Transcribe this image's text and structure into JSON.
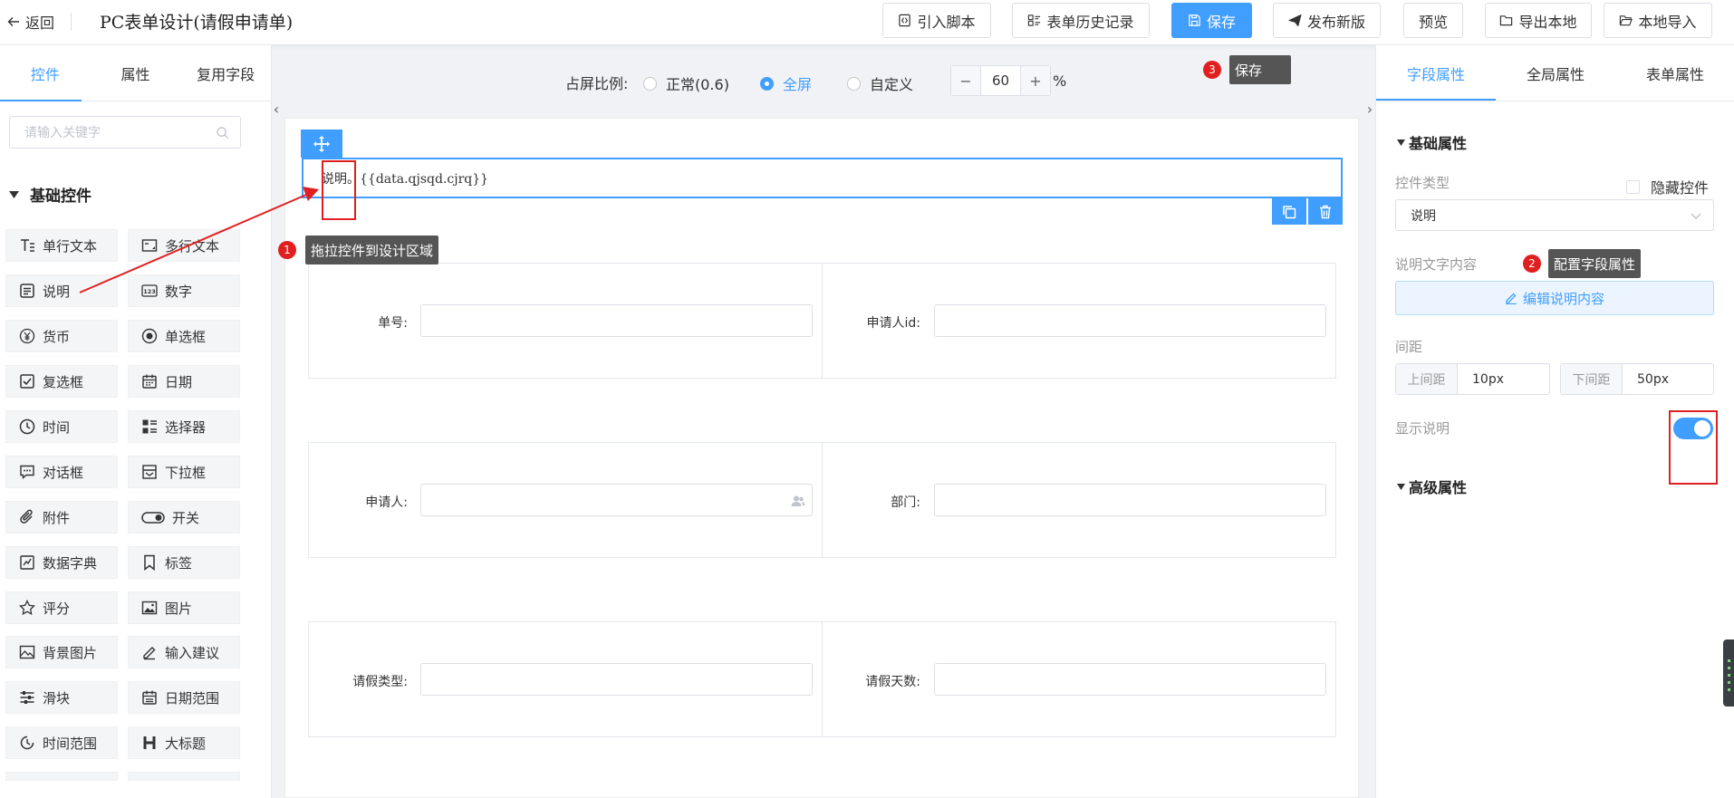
{
  "header": {
    "back_label": "返回",
    "title": "PC表单设计(请假申请单)",
    "buttons": {
      "import_script": "引入脚本",
      "history": "表单历史记录",
      "save": "保存",
      "publish": "发布新版",
      "preview": "预览",
      "export_local": "导出本地",
      "import_local": "本地导入"
    }
  },
  "left_panel": {
    "tabs": [
      "控件",
      "属性",
      "复用字段"
    ],
    "active_tab": 0,
    "search_placeholder": "请输入关键字",
    "section_title": "基础控件",
    "controls": [
      {
        "label": "单行文本",
        "icon": "single-line-text-icon"
      },
      {
        "label": "多行文本",
        "icon": "multi-line-text-icon"
      },
      {
        "label": "说明",
        "icon": "description-icon"
      },
      {
        "label": "数字",
        "icon": "number-icon"
      },
      {
        "label": "货币",
        "icon": "currency-icon"
      },
      {
        "label": "单选框",
        "icon": "radio-icon"
      },
      {
        "label": "复选框",
        "icon": "checkbox-icon"
      },
      {
        "label": "日期",
        "icon": "calendar-icon"
      },
      {
        "label": "时间",
        "icon": "clock-icon"
      },
      {
        "label": "选择器",
        "icon": "selector-icon"
      },
      {
        "label": "对话框",
        "icon": "dialog-icon"
      },
      {
        "label": "下拉框",
        "icon": "dropdown-icon"
      },
      {
        "label": "附件",
        "icon": "attachment-icon"
      },
      {
        "label": "开关",
        "icon": "switch-icon"
      },
      {
        "label": "数据字典",
        "icon": "data-dictionary-icon"
      },
      {
        "label": "标签",
        "icon": "tag-icon"
      },
      {
        "label": "评分",
        "icon": "star-icon"
      },
      {
        "label": "图片",
        "icon": "image-icon"
      },
      {
        "label": "背景图片",
        "icon": "background-image-icon"
      },
      {
        "label": "输入建议",
        "icon": "input-suggestion-icon"
      },
      {
        "label": "滑块",
        "icon": "slider-icon"
      },
      {
        "label": "日期范围",
        "icon": "date-range-icon"
      },
      {
        "label": "时间范围",
        "icon": "time-range-icon"
      },
      {
        "label": "大标题",
        "icon": "heading-icon"
      }
    ]
  },
  "canvas": {
    "ratio_label": "占屏比例:",
    "ratio_options": [
      "正常(0.6)",
      "全屏",
      "自定义"
    ],
    "ratio_selected": 1,
    "custom_value": "60",
    "percent_sign": "%",
    "stepper_minus": "−",
    "stepper_plus": "+",
    "selected_field_text": "说明。{{data.qjsqd.cjrq}}",
    "form_rows": [
      [
        {
          "label": "单号:"
        },
        {
          "label": "申请人id:"
        }
      ],
      [
        {
          "label": "申请人:",
          "icon": "user-picker-icon"
        },
        {
          "label": "部门:"
        }
      ],
      [
        {
          "label": "请假类型:"
        },
        {
          "label": "请假天数:"
        }
      ]
    ]
  },
  "annotations": [
    {
      "number": "1",
      "text": "拖拉控件到设计区域"
    },
    {
      "number": "2",
      "text": "配置字段属性"
    },
    {
      "number": "3",
      "text": "保存"
    }
  ],
  "right_panel": {
    "tabs": [
      "字段属性",
      "全局属性",
      "表单属性"
    ],
    "active_tab": 0,
    "basic_section": "基础属性",
    "control_type_label": "控件类型",
    "hide_control_label": "隐藏控件",
    "control_type_value": "说明",
    "desc_content_label": "说明文字内容",
    "edit_desc_button": "编辑说明内容",
    "spacing_label": "间距",
    "top_spacing_label": "上间距",
    "top_spacing_value": "10px",
    "bottom_spacing_label": "下间距",
    "bottom_spacing_value": "50px",
    "show_desc_label": "显示说明",
    "show_desc_on": true,
    "advanced_section": "高级属性"
  },
  "colors": {
    "primary": "#409eff",
    "annotation_red": "#e02020",
    "tooltip_bg": "#555555"
  }
}
